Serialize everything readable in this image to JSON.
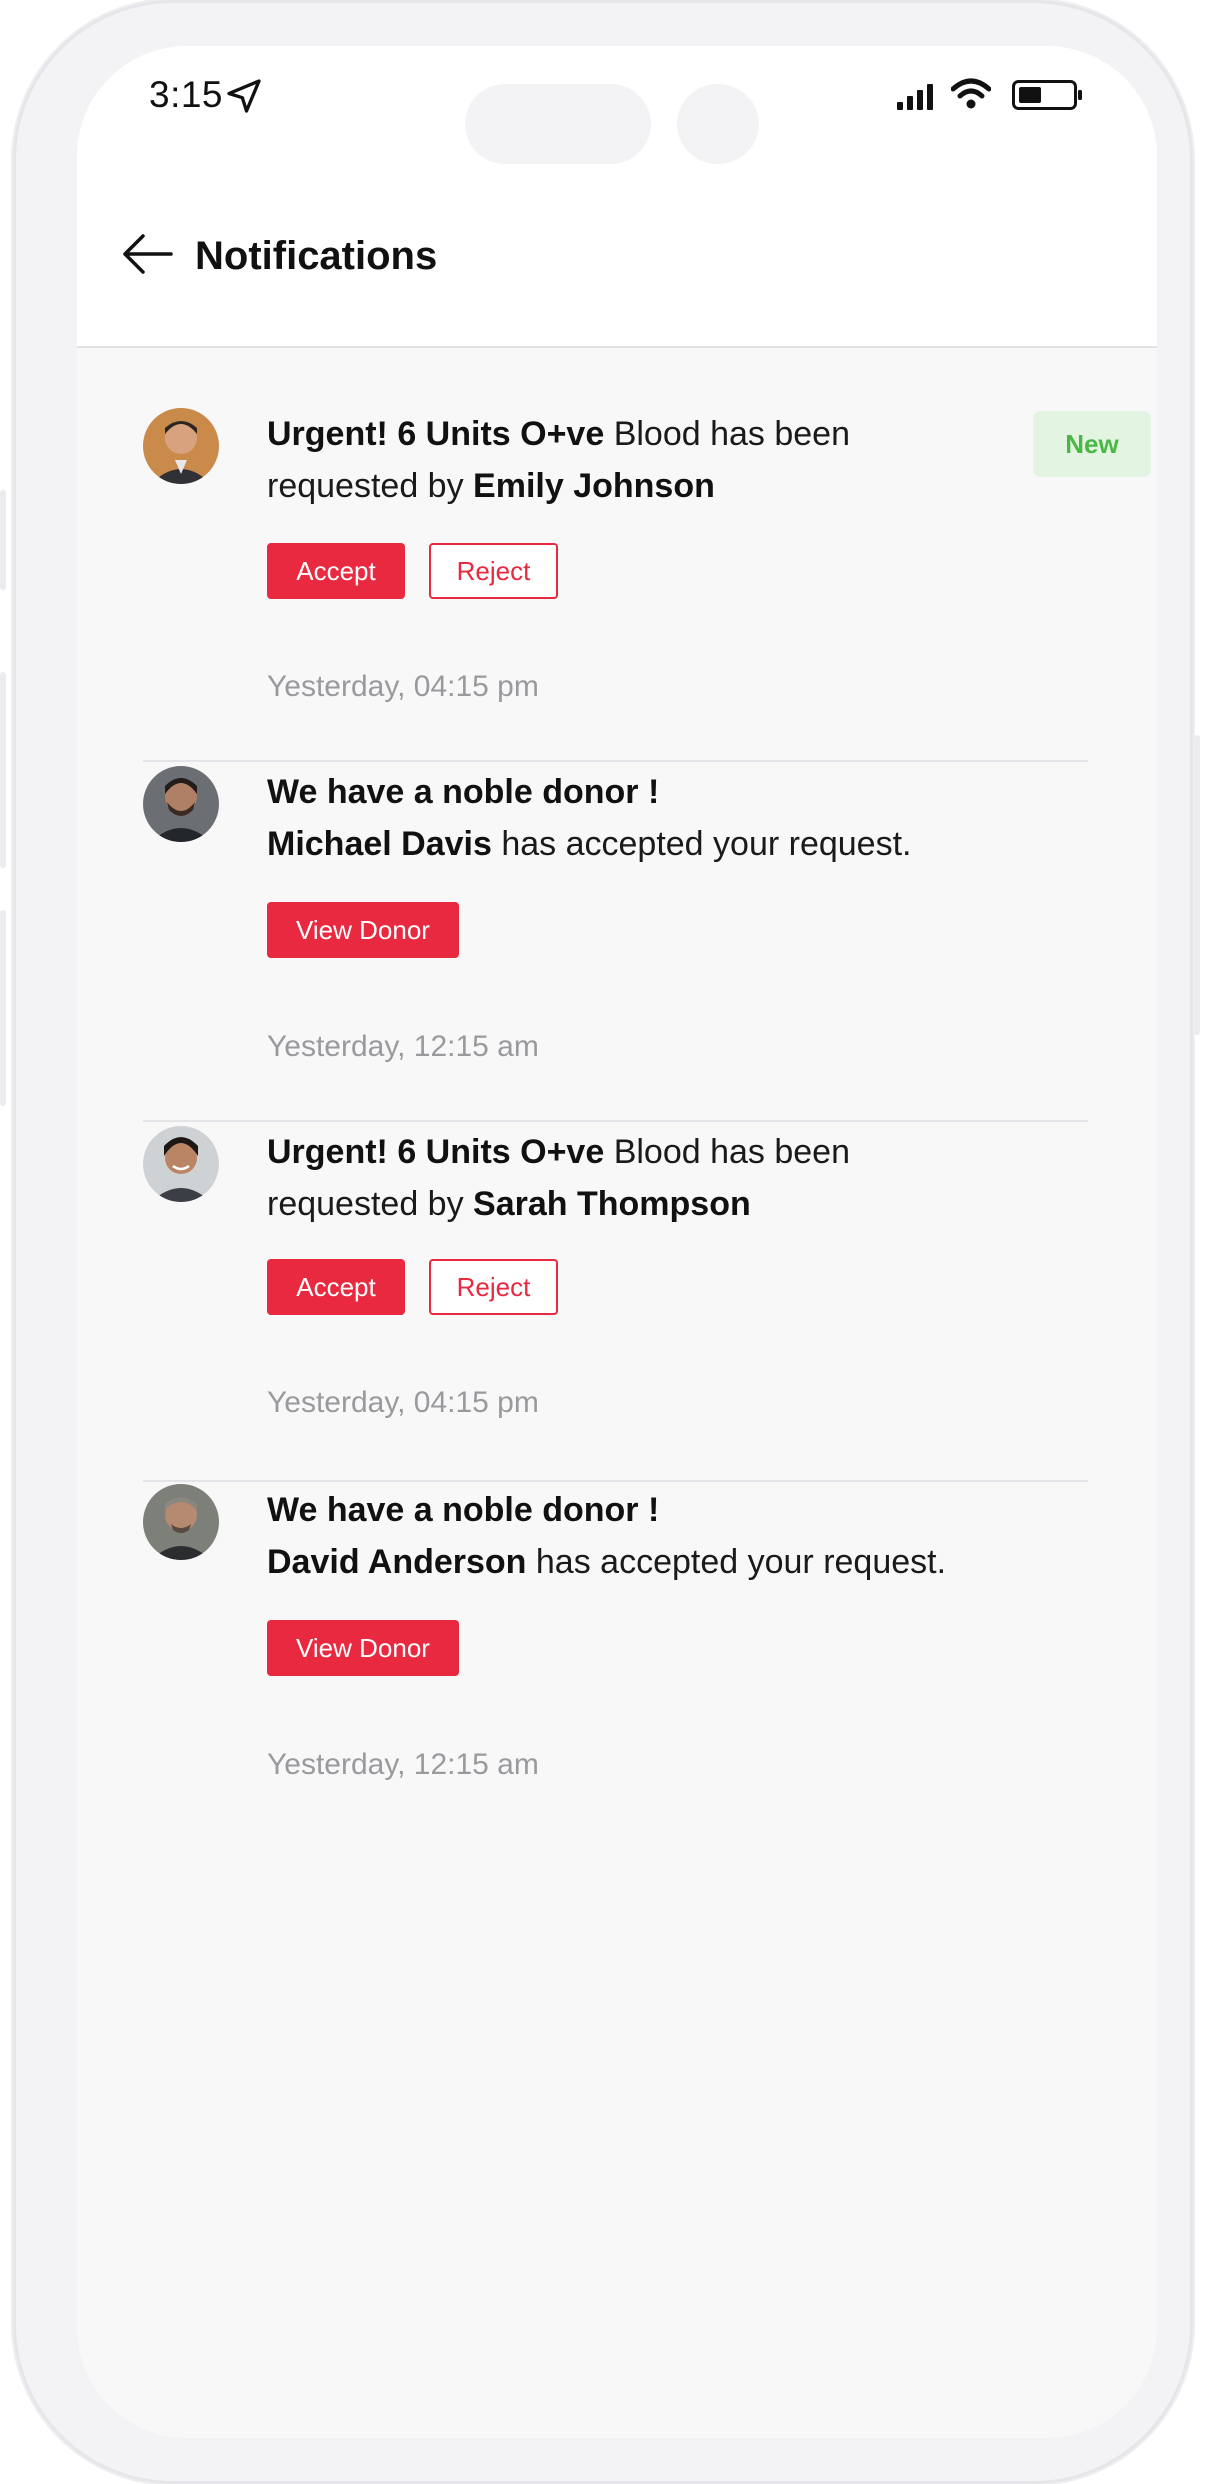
{
  "status_bar": {
    "time": "3:15",
    "icons": [
      "location-arrow-icon",
      "cellular-signal-icon",
      "wifi-icon",
      "battery-icon"
    ]
  },
  "header": {
    "title": "Notifications",
    "back_icon": "arrow-left-icon"
  },
  "notifications": [
    {
      "type": "request",
      "bold_lead": "Urgent! 6 Units O+ve",
      "text_mid": " Blood has been requested by ",
      "name": "Emily Johnson",
      "badge": "New",
      "accept_label": "Accept",
      "reject_label": "Reject",
      "time": "Yesterday, 04:15 pm"
    },
    {
      "type": "donor",
      "heading": "We have a noble donor !",
      "name": "Michael Davis",
      "text_tail": " has accepted your request.",
      "button_label": "View Donor",
      "time": "Yesterday, 12:15 am"
    },
    {
      "type": "request",
      "bold_lead": "Urgent! 6 Units O+ve",
      "text_mid": " Blood has been requested by ",
      "name": "Sarah Thompson",
      "accept_label": "Accept",
      "reject_label": "Reject",
      "time": "Yesterday, 04:15 pm"
    },
    {
      "type": "donor",
      "heading": "We have a noble donor !",
      "name": "David Anderson",
      "text_tail": " has accepted your request.",
      "button_label": "View Donor",
      "time": "Yesterday, 12:15 am"
    }
  ],
  "colors": {
    "accent": "#e8293f",
    "badge_bg": "#e4f4e2",
    "badge_text": "#4bb846",
    "muted_text": "#9a9a9e",
    "screen_bg": "#f8f8f9"
  }
}
